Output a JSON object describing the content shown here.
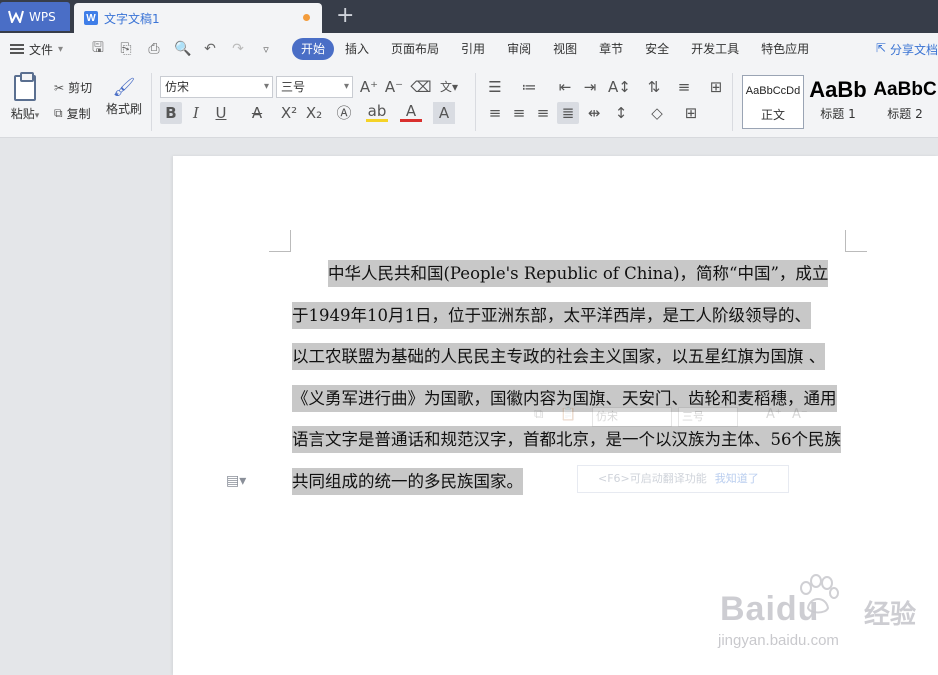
{
  "titlebar": {
    "app_tab": "WPS",
    "doc_tab": "文字文稿1",
    "new_tab_symbol": "+"
  },
  "menubar": {
    "file_label": "文件",
    "items": [
      {
        "label": "开始",
        "active": true
      },
      {
        "label": "插入"
      },
      {
        "label": "页面布局"
      },
      {
        "label": "引用"
      },
      {
        "label": "审阅"
      },
      {
        "label": "视图"
      },
      {
        "label": "章节"
      },
      {
        "label": "安全"
      },
      {
        "label": "开发工具"
      },
      {
        "label": "特色应用"
      }
    ],
    "share_label": "分享文档"
  },
  "ribbon": {
    "paste_label": "粘贴",
    "cut_label": "剪切",
    "copy_label": "复制",
    "format_painter_label": "格式刷",
    "font_name": "仿宋",
    "font_size": "三号",
    "bold_label": "B",
    "italic_label": "I",
    "underline_label": "U",
    "styles": [
      {
        "sample": "AaBbCcDd",
        "name": "正文"
      },
      {
        "sample": "AaBb",
        "name": "标题 1"
      },
      {
        "sample": "AaBbC",
        "name": "标题 2"
      }
    ]
  },
  "document": {
    "lines": [
      "中华人民共和国(People's Republic of China)，简称“中国”，成立",
      "于1949年10月1日，位于亚洲东部，太平洋西岸，是工人阶级领导的、",
      "以工农联盟为基础的人民民主专政的社会主义国家，以五星红旗为国旗 、",
      "《义勇军进行曲》为国歌，国徽内容为国旗、天安门、齿轮和麦稻穗，通用",
      "语言文字是普通话和规范汉字，首都北京，是一个以汉族为主体、56个民族",
      "共同组成的统一的多民族国家。"
    ]
  },
  "overlay": {
    "mini_font": "仿宋",
    "mini_size": "三号",
    "tip_text": "<F6>可启动翻译功能",
    "tip_link": "我知道了"
  },
  "watermark": {
    "brand": "Baidu",
    "brand_cn": "经验",
    "url": "jingyan.baidu.com"
  },
  "colors": {
    "titlebar_bg": "#373d49",
    "accent": "#4a6ec6",
    "highlight": "#c8c8c8"
  }
}
